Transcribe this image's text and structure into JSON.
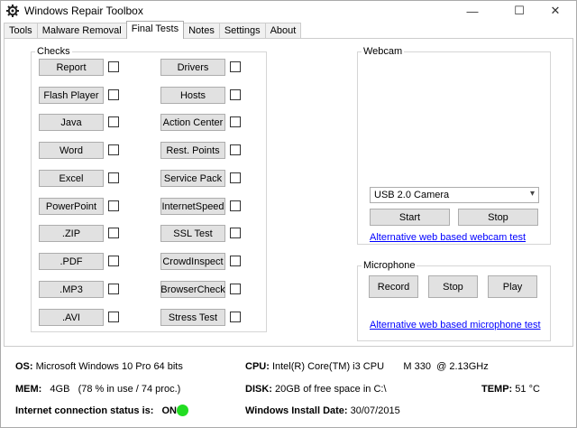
{
  "window": {
    "title": "Windows Repair Toolbox",
    "minimize": "—",
    "maximize": "☐",
    "close": "✕"
  },
  "tabs": [
    {
      "label": "Tools"
    },
    {
      "label": "Malware Removal"
    },
    {
      "label": "Final Tests"
    },
    {
      "label": "Notes"
    },
    {
      "label": "Settings"
    },
    {
      "label": "About"
    }
  ],
  "checks": {
    "title": "Checks",
    "left": [
      "Report",
      "Flash Player",
      "Java",
      "Word",
      "Excel",
      "PowerPoint",
      ".ZIP",
      ".PDF",
      ".MP3",
      ".AVI"
    ],
    "right": [
      "Drivers",
      "Hosts",
      "Action Center",
      "Rest. Points",
      "Service Pack",
      "InternetSpeed",
      "SSL Test",
      "CrowdInspect",
      "BrowserCheck",
      "Stress Test"
    ]
  },
  "webcam": {
    "title": "Webcam",
    "device": "USB 2.0 Camera",
    "start": "Start",
    "stop": "Stop",
    "link": "Alternative web based webcam test"
  },
  "microphone": {
    "title": "Microphone",
    "record": "Record",
    "stop": "Stop",
    "play": "Play",
    "link": "Alternative web based microphone test"
  },
  "status": {
    "os_label": "OS:",
    "os_value": "Microsoft Windows 10 Pro 64 bits",
    "cpu_label": "CPU:",
    "cpu_value": "Intel(R) Core(TM) i3 CPU       M 330  @ 2.13GHz",
    "mem_label": "MEM:",
    "mem_value": "4GB   (78 % in use / 74 proc.)",
    "disk_label": "DISK:",
    "disk_value": "20GB of free space in C:\\",
    "temp_label": "TEMP:",
    "temp_value": "51 °C",
    "internet_label": "Internet connection status is:",
    "internet_value": "ON",
    "install_label": "Windows Install Date:",
    "install_value": "30/07/2015",
    "internet_color": "#22dd22"
  }
}
